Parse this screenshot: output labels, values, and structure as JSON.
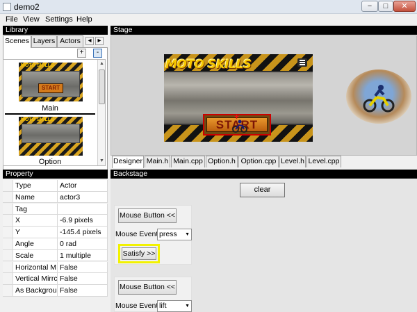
{
  "window": {
    "title": "demo2",
    "controls": {
      "minimize": "−",
      "maximize": "□",
      "close": "✕"
    }
  },
  "menubar": {
    "items": [
      "File",
      "View",
      "Settings",
      "Help"
    ]
  },
  "library": {
    "header": "Library",
    "tabs": [
      "Scenes",
      "Layers",
      "Actors"
    ],
    "active_tab": "Scenes",
    "nav_buttons": {
      "prev": "◂",
      "next": "▸"
    },
    "add_button": "+",
    "remove_button": "-",
    "scenes": [
      {
        "name": "Main",
        "thumb_logo": "MOTO SKILLS",
        "thumb_button": "START"
      },
      {
        "name": "Option",
        "thumb_logo": "MOTO SKILLS",
        "thumb_button": ""
      }
    ]
  },
  "property": {
    "header": "Property",
    "rows": [
      {
        "key": "Type",
        "value": "Actor"
      },
      {
        "key": "Name",
        "value": "actor3"
      },
      {
        "key": "Tag",
        "value": ""
      },
      {
        "key": "X",
        "value": "-6.9 pixels"
      },
      {
        "key": "Y",
        "value": "-145.4 pixels"
      },
      {
        "key": "Angle",
        "value": "0 rad"
      },
      {
        "key": "Scale",
        "value": "1 multiple"
      },
      {
        "key": "Horizontal M",
        "value": "False"
      },
      {
        "key": "Vertical Mirrc",
        "value": "False"
      },
      {
        "key": "As Backgrour",
        "value": "False"
      }
    ]
  },
  "stage": {
    "header": "Stage",
    "game_logo": "MOTO SKILLS",
    "start_label": "START",
    "crosshair": "+",
    "tabs": [
      "Designer",
      "Main.h",
      "Main.cpp",
      "Option.h",
      "Option.cpp",
      "Level.h",
      "Level.cpp"
    ],
    "active_tab": "Designer"
  },
  "backstage": {
    "header": "Backstage",
    "clear_label": "clear",
    "blocks": [
      {
        "button_label": "Mouse Button <<",
        "event_label": "Mouse Event",
        "event_value": "press",
        "satisfy_label": "Satisfy >>",
        "highlighted": true
      },
      {
        "button_label": "Mouse Button <<",
        "event_label": "Mouse Event",
        "event_value": "lift",
        "satisfy_label": "",
        "highlighted": false
      }
    ]
  },
  "colors": {
    "panel_header_bg": "#000000",
    "highlight": "#f2f200",
    "selection_outline": "#cc0000",
    "crosshair": "#ee1111"
  }
}
